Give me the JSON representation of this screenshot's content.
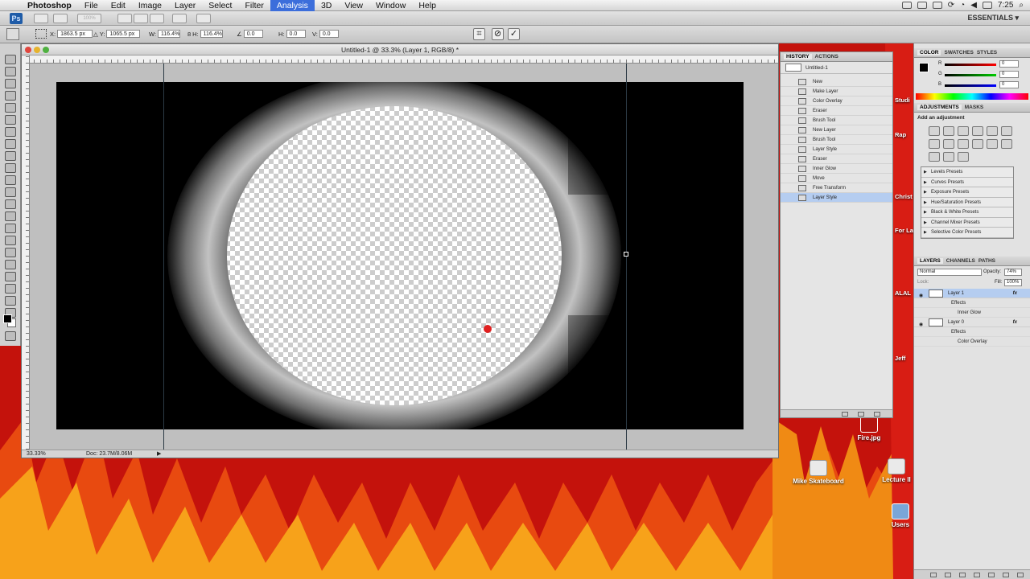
{
  "menubar": {
    "app": "Photoshop",
    "items": [
      "File",
      "Edit",
      "Image",
      "Layer",
      "Select",
      "Filter",
      "Analysis",
      "3D",
      "View",
      "Window",
      "Help"
    ],
    "active": "Analysis",
    "clock": "7:25"
  },
  "appbar": {
    "workspace": "ESSENTIALS ▾",
    "zoom_placeholder": "100%"
  },
  "options": {
    "x_label": "X:",
    "x_value": "1863.5 px",
    "y_label": "Y:",
    "y_value": "1065.5 px",
    "w_label": "W:",
    "w_value": "116.4%",
    "h_label": "H:",
    "h_value": "116.4%",
    "angle_value": "0.0",
    "hskew_label": "H:",
    "hskew_value": "0.0",
    "vskew_label": "V:",
    "vskew_value": "0.0",
    "cancel_icon": "cancel-transform-icon",
    "commit_icon": "commit-transform-icon"
  },
  "document": {
    "title": "Untitled-1 @ 33.3% (Layer 1, RGB/8) *",
    "zoom": "33.33%",
    "doc_info": "Doc: 23.7M/8.06M"
  },
  "history_panel": {
    "tabs": [
      "HISTORY",
      "ACTIONS"
    ],
    "snapshot": "Untitled-1",
    "items": [
      "New",
      "Make Layer",
      "Color Overlay",
      "Eraser",
      "Brush Tool",
      "New Layer",
      "Brush Tool",
      "Layer Style",
      "Eraser",
      "Inner Glow",
      "Move",
      "Free Transform",
      "Layer Style"
    ],
    "selected_index": 12
  },
  "color_panel": {
    "tabs": [
      "COLOR",
      "SWATCHES",
      "STYLES"
    ],
    "r_label": "R",
    "g_label": "G",
    "b_label": "B",
    "r_value": "0",
    "g_value": "0",
    "b_value": "0"
  },
  "adjustments_panel": {
    "tabs": [
      "ADJUSTMENTS",
      "MASKS"
    ],
    "heading": "Add an adjustment",
    "presets": [
      "Levels Presets",
      "Curves Presets",
      "Exposure Presets",
      "Hue/Saturation Presets",
      "Black & White Presets",
      "Channel Mixer Presets",
      "Selective Color Presets"
    ]
  },
  "layers_panel": {
    "tabs": [
      "LAYERS",
      "CHANNELS",
      "PATHS"
    ],
    "blend_mode": "Normal",
    "opacity_label": "Opacity:",
    "opacity_value": "74%",
    "lock_label": "Lock:",
    "fill_label": "Fill:",
    "fill_value": "100%",
    "layers": [
      {
        "name": "Layer 1",
        "effects_label": "Effects",
        "effect": "Inner Glow",
        "fx": "fx"
      },
      {
        "name": "Layer 0",
        "effects_label": "Effects",
        "effect": "Color Overlay",
        "fx": "fx"
      }
    ]
  },
  "desktop": {
    "icons": [
      "Fire.jpg",
      "Mike Skateboard",
      "Lecture II",
      "Users"
    ],
    "side_labels": [
      "Studi",
      "Rap",
      "Christ",
      "For La",
      "ALAL",
      "Jeff"
    ]
  }
}
